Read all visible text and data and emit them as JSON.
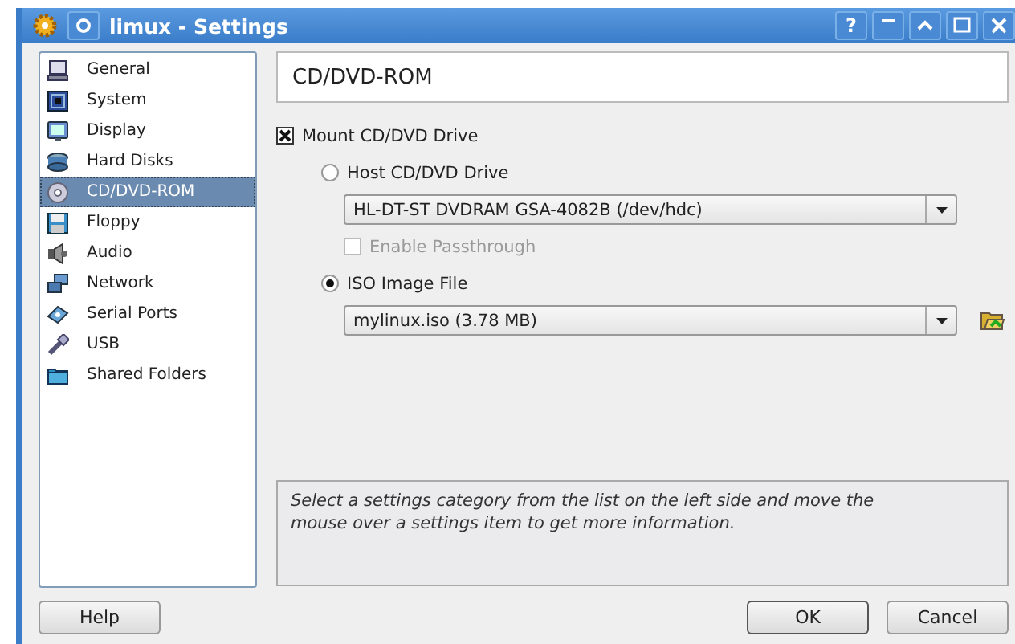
{
  "window": {
    "title": "limux - Settings",
    "help_glyph": "?"
  },
  "sidebar": {
    "items": [
      {
        "label": "General",
        "kind": "general",
        "selected": false
      },
      {
        "label": "System",
        "kind": "system",
        "selected": false
      },
      {
        "label": "Display",
        "kind": "display",
        "selected": false
      },
      {
        "label": "Hard Disks",
        "kind": "disks",
        "selected": false
      },
      {
        "label": "CD/DVD-ROM",
        "kind": "cdrom",
        "selected": true
      },
      {
        "label": "Floppy",
        "kind": "floppy",
        "selected": false
      },
      {
        "label": "Audio",
        "kind": "audio",
        "selected": false
      },
      {
        "label": "Network",
        "kind": "network",
        "selected": false
      },
      {
        "label": "Serial Ports",
        "kind": "serial",
        "selected": false
      },
      {
        "label": "USB",
        "kind": "usb",
        "selected": false
      },
      {
        "label": "Shared Folders",
        "kind": "folder",
        "selected": false
      }
    ]
  },
  "panel": {
    "title": "CD/DVD-ROM",
    "mount": {
      "label": "Mount CD/DVD Drive",
      "checked": true
    },
    "host": {
      "label": "Host CD/DVD Drive",
      "selected": false
    },
    "host_drive": {
      "value": "HL-DT-ST DVDRAM GSA-4082B (/dev/hdc)"
    },
    "passthrough": {
      "label": "Enable Passthrough",
      "checked": false,
      "disabled": true
    },
    "iso": {
      "label": "ISO Image File",
      "selected": true
    },
    "iso_file": {
      "value": "mylinux.iso (3.78 MB)"
    }
  },
  "info": {
    "text": "Select a settings category from the list on the left side and move the mouse over a settings item to get more information."
  },
  "buttons": [
    {
      "label": "Help",
      "default": false
    },
    {
      "label": "OK",
      "default": true
    },
    {
      "label": "Cancel",
      "default": false
    }
  ]
}
